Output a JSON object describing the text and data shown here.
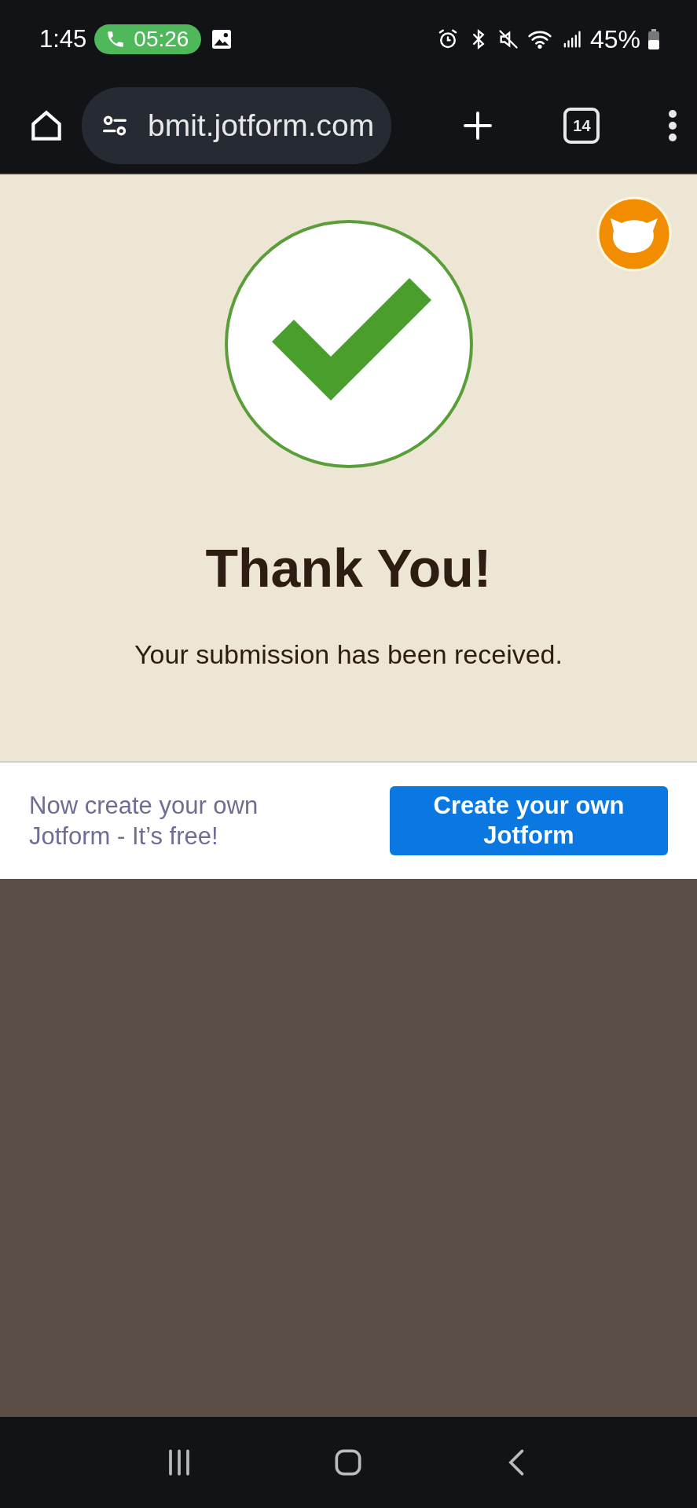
{
  "status_bar": {
    "time": "1:45",
    "call_timer": "05:26",
    "battery": "45%"
  },
  "browser": {
    "url": "bmit.jotform.com",
    "tab_count": "14"
  },
  "thank_you": {
    "title": "Thank You!",
    "message": "Your submission has been received."
  },
  "promo": {
    "text": "Now create your own Jotform - It’s free!",
    "button": "Create your own Jotform"
  }
}
